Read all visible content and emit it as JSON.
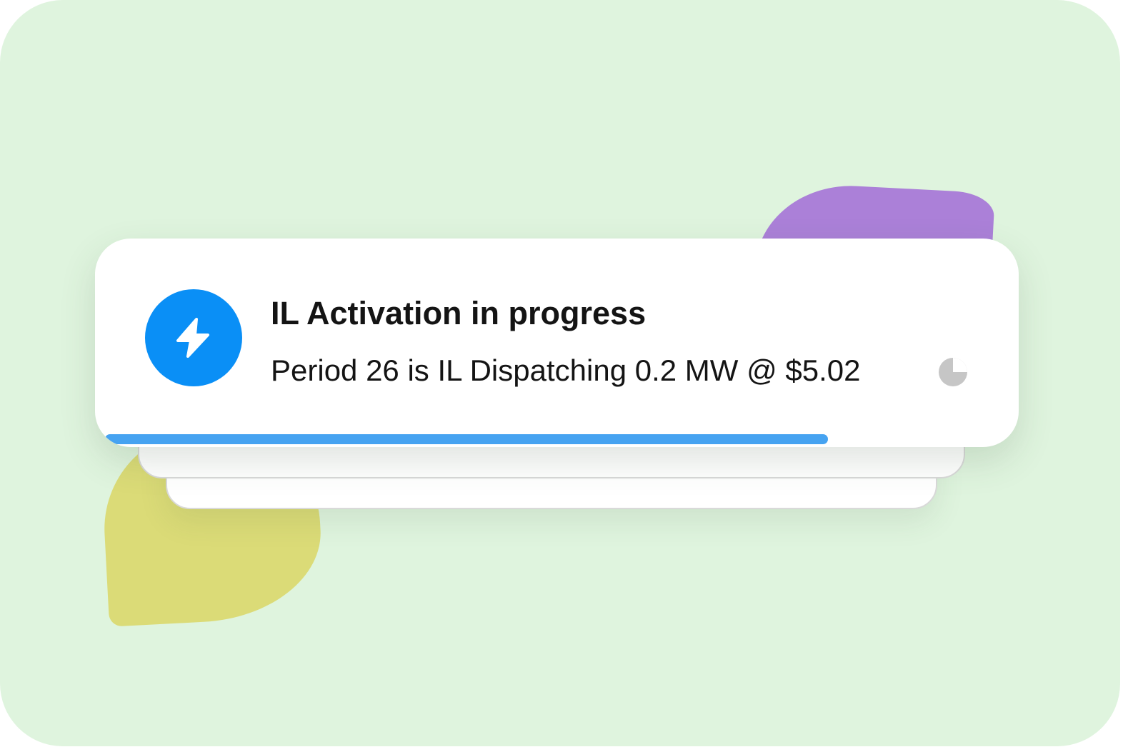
{
  "notification": {
    "title": "IL Activation in progress",
    "message": "Period 26 is IL Dispatching 0.2 MW @ $5.02",
    "icon": "lightning-bolt-icon",
    "status_icon": "countdown-timer-icon",
    "progress_fraction": 0.8,
    "countdown_elapsed_fraction": 0.75
  },
  "colors": {
    "background": "#dff4de",
    "icon_circle": "#0a8ff6",
    "progress_bar": "#46a3f1",
    "accent_purple": "#ab80d8",
    "accent_yellow": "#dbdb77",
    "timer": "#c6c6c6"
  }
}
